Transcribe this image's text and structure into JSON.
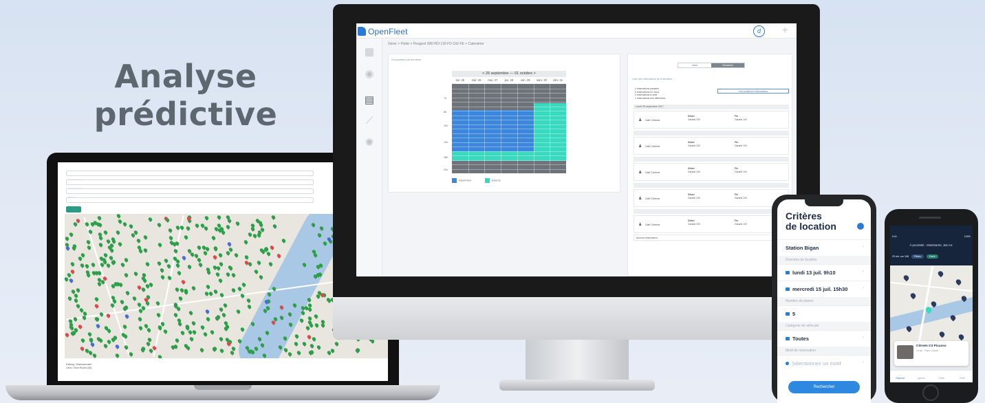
{
  "headline": {
    "line1": "Analyse",
    "line2": "prédictive"
  },
  "monitor": {
    "logo": "OpenFleet",
    "avatar_glyph": "d",
    "breadcrumb": "Gérer > Flotte > Peugeot 308 HDI 130 FD-102-FE > Calendrier",
    "left_panel": {
      "title": "Occupation par semaine",
      "range_label": "< 26 septembre — 01 octobre >",
      "days": [
        "lun. 25",
        "mar. 26",
        "mer. 27",
        "jeu. 28",
        "ven. 29",
        "sam. 30",
        "dim. 31"
      ],
      "legend": {
        "blue": "OpenFleet",
        "teal": "Externe"
      },
      "colors": {
        "blue": "#3c86dc",
        "teal": "#38d9be",
        "grey": "#6d7379"
      }
    },
    "right_panel": {
      "toggle": [
        "Jours",
        "Semaines"
      ],
      "subtitle": "Liste des réservations de la semaine",
      "stats": [
        "4 réservations passées",
        "0 réservations en cours",
        "0 réservations à venir",
        "1 réservations non effectuées"
      ],
      "button": "Voir toutes les réservations",
      "days": [
        {
          "date": "Lundi 25 septembre 2017",
          "cards": 1
        },
        {
          "date": "",
          "cards": 1
        },
        {
          "date": "",
          "cards": 1
        },
        {
          "date": "",
          "cards": 1
        },
        {
          "date": "",
          "cards": 1
        }
      ],
      "card": {
        "driver": "Gaël Ortheme",
        "start": "Début",
        "end": "Fin",
        "station": "Garanti 100"
      },
      "empty_day": "Aucune réservation"
    }
  },
  "laptop": {
    "fields": [
      "Lieu / commune",
      "Lot / commune",
      "Marque",
      "Modèle"
    ],
    "button": "Filtrer",
    "footer": [
      "Parking / Stationnement",
      "Lieux / Nord Rouen (46)"
    ]
  },
  "phone1": {
    "title_line1": "Critères",
    "title_line2": "de location",
    "station": "Station Bigan",
    "section_dates": "Données de location",
    "date_from": "lundi 13 juil. 9h10",
    "date_to": "mercredi 15 juil. 15h30",
    "section_seats": "Nombre de places",
    "seats": "5",
    "section_category": "Catégorie de véhicule",
    "category": "Toutes",
    "section_reason": "Motif de réservation",
    "reason": "Sélectionnez un motif",
    "button": "Rechercher"
  },
  "phone2": {
    "status_time": "9:41",
    "status_right": "100%",
    "location": "À proximité · Montmartre, 18e Arr.",
    "count": "23 rés. sur 108",
    "chip1": "Filtres",
    "chip2": "Carte",
    "car_name": "Citroën C3 Picasso",
    "car_sub": "10 km · Paris | Ouest",
    "nav": [
      "Réserver",
      "Agenda",
      "Flotte",
      "Profil"
    ]
  }
}
